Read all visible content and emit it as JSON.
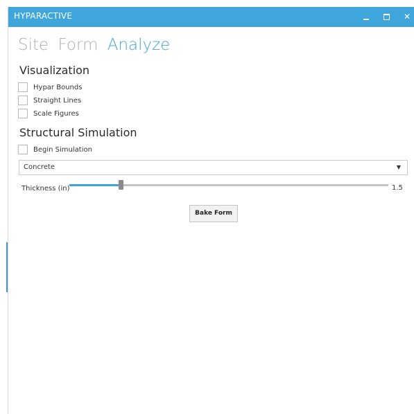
{
  "window": {
    "title": "HYPARACTIVE",
    "titlebar_color": "#3fa6dc",
    "controls": {
      "minimize": "minimize-icon",
      "maximize": "maximize-icon",
      "close_glyph": "✕"
    }
  },
  "nav": {
    "tabs": [
      {
        "label": "Site",
        "active": false
      },
      {
        "label": "Form",
        "active": false
      },
      {
        "label": "Analyze",
        "active": true
      }
    ],
    "active_color": "#4aa3d8",
    "inactive_color": "#b0b0b0"
  },
  "visualization": {
    "title": "Visualization",
    "options": [
      {
        "label": "Hypar Bounds",
        "checked": false
      },
      {
        "label": "Straight Lines",
        "checked": false
      },
      {
        "label": "Scale Figures",
        "checked": false
      }
    ]
  },
  "simulation": {
    "title": "Structural Simulation",
    "begin": {
      "label": "Begin Simulation",
      "checked": false
    },
    "material": {
      "selected": "Concrete",
      "caret": "▼"
    },
    "thickness": {
      "label": "Thickness (in)",
      "value": "1.5",
      "fraction": 0.16
    },
    "bake_button": "Bake Form"
  }
}
